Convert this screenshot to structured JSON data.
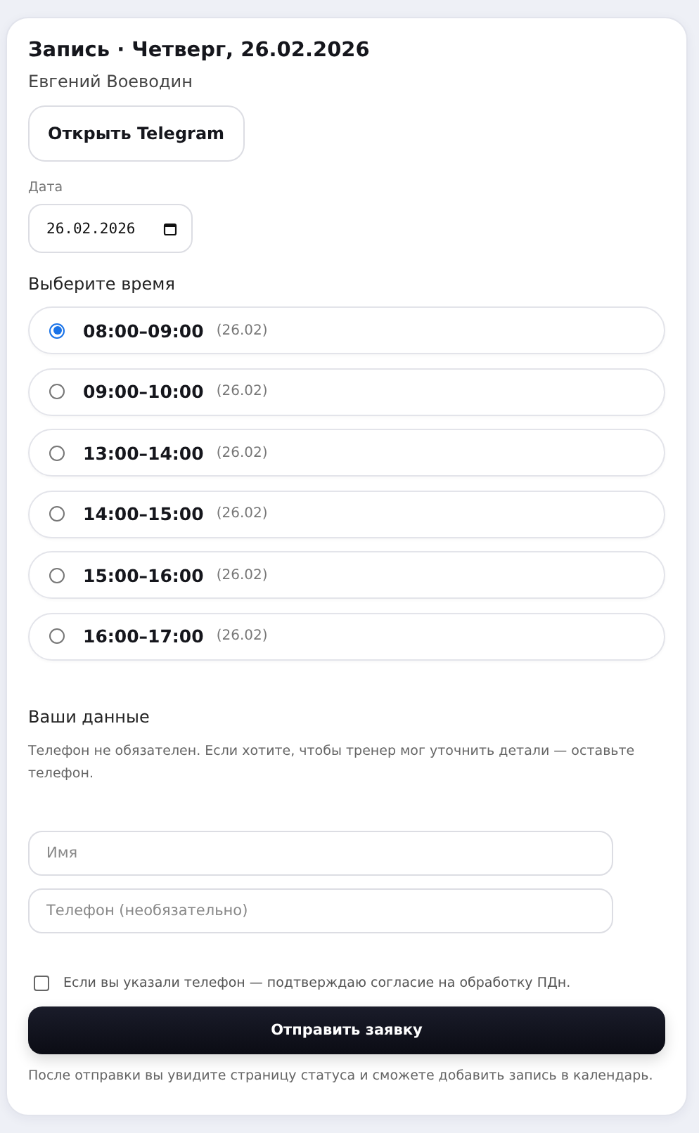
{
  "header": {
    "title": "Запись · Четверг, 26.02.2026",
    "subtitle": "Евгений Воеводин"
  },
  "telegram_button": "Открыть Telegram",
  "date_field": {
    "label": "Дата",
    "value": "26.02.2026"
  },
  "time_section": {
    "heading": "Выберите время",
    "slots": [
      {
        "time": "08:00–09:00",
        "date": "(26.02)",
        "selected": true
      },
      {
        "time": "09:00–10:00",
        "date": "(26.02)",
        "selected": false
      },
      {
        "time": "13:00–14:00",
        "date": "(26.02)",
        "selected": false
      },
      {
        "time": "14:00–15:00",
        "date": "(26.02)",
        "selected": false
      },
      {
        "time": "15:00–16:00",
        "date": "(26.02)",
        "selected": false
      },
      {
        "time": "16:00–17:00",
        "date": "(26.02)",
        "selected": false
      }
    ]
  },
  "contact_section": {
    "heading": "Ваши данные",
    "hint": "Телефон не обязателен. Если хотите, чтобы тренер мог уточнить детали — оставьте телефон.",
    "fields": [
      {
        "placeholder": "Имя"
      },
      {
        "placeholder": "Телефон (необязательно)"
      }
    ]
  },
  "consent": {
    "label": "Если вы указали телефон — подтверждаю согласие на обработку ПДн.",
    "checked": false
  },
  "submit_button": "Отправить заявку",
  "footer_note": "После отправки вы увидите страницу статуса и сможете добавить запись в календарь."
}
